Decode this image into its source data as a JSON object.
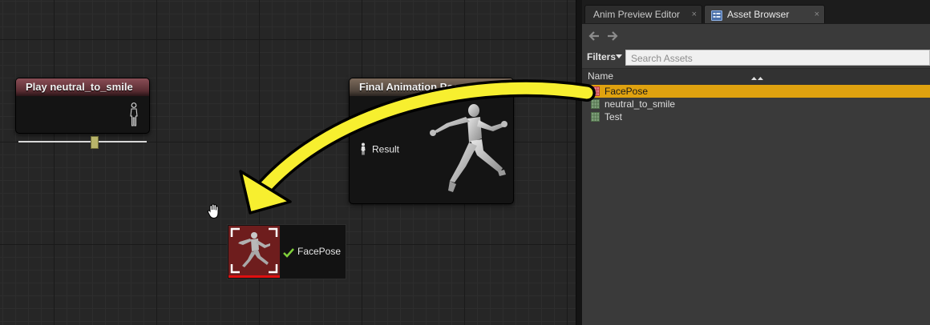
{
  "graph": {
    "play_node": {
      "title": "Play neutral_to_smile",
      "icon": "person-pose-icon",
      "slider_value": 0.59
    },
    "final_node": {
      "title": "Final Animation Pose",
      "pin_label": "Result",
      "icon": "running-mannequin-icon"
    },
    "drag_preview": {
      "label": "FacePose",
      "icon": "checkmark-icon",
      "thumbnail": "pose-asset-thumbnail"
    },
    "cursor": "grab-hand-icon",
    "annotation": "yellow-drag-arrow"
  },
  "panel": {
    "tabs": [
      {
        "label": "Anim Preview Editor",
        "close": "×"
      },
      {
        "label": "Asset Browser",
        "close": "×",
        "icon": "asset-browser-icon"
      }
    ],
    "nav": {
      "back": "🡐",
      "forward": "🡒"
    },
    "filters_label": "Filters",
    "search_placeholder": "Search Assets",
    "column_name": "Name",
    "assets": [
      {
        "label": "FacePose",
        "icon": "pose-asset-icon",
        "selected": true
      },
      {
        "label": "neutral_to_smile",
        "icon": "animation-sequence-icon",
        "selected": false
      },
      {
        "label": "Test",
        "icon": "animation-sequence-icon",
        "selected": false
      }
    ]
  },
  "colors": {
    "selection": "#e0a20f",
    "arrow": "#f7ef2f",
    "play_header": "#7a4049",
    "final_header": "#6e5f52"
  }
}
